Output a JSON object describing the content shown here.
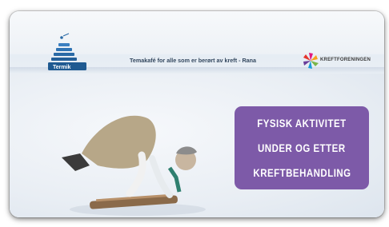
{
  "banner": {
    "logo_text": "Termik",
    "event_title": "Temakafé for alle som er berørt av kreft - Rana",
    "partner_name": "KREFTFORENINGEN",
    "headline_lines": [
      "FYSISK AKTIVITET",
      "UNDER OG ETTER",
      "KREFTBEHANDLING"
    ]
  },
  "colors": {
    "headline_bg": "#7d5aa8",
    "logo_blue": "#2a6aa6",
    "title_text": "#34485f"
  },
  "icons": [
    "logo-icon",
    "kreftforeningen-flower-icon"
  ]
}
